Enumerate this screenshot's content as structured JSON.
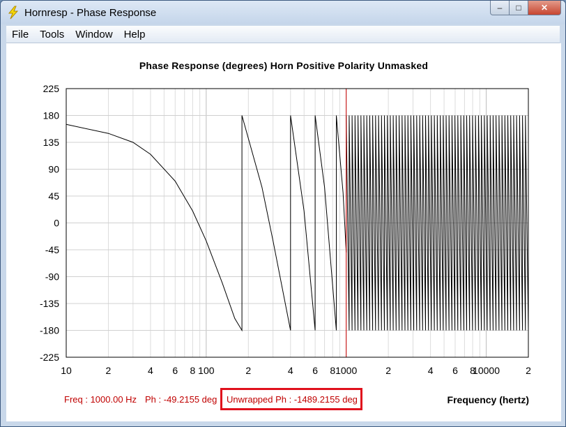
{
  "window": {
    "title": "Hornresp - Phase Response",
    "controls": {
      "minimize": "–",
      "maximize": "□",
      "close": "✕"
    }
  },
  "menu": [
    {
      "label": "File",
      "key": "file"
    },
    {
      "label": "Tools",
      "key": "tools"
    },
    {
      "label": "Window",
      "key": "window"
    },
    {
      "label": "Help",
      "key": "help"
    }
  ],
  "status": {
    "freq": "Freq : 1000.00 Hz",
    "phase": "Ph : -49.2155 deg",
    "unwrapped": "Unwrapped Ph : -1489.2155 deg"
  },
  "colors": {
    "status": "#c00000",
    "highlight": "#e0101c",
    "marker": "#cc0000",
    "trace": "#000000",
    "grid": "#cccccc"
  },
  "chart_data": {
    "type": "line",
    "title": "Phase Response (degrees)   Horn   Positive Polarity   Unmasked",
    "xlabel": "Frequency (hertz)",
    "ylabel": "",
    "xscale": "log",
    "xlim": [
      10,
      20000
    ],
    "ylim": [
      -225,
      225
    ],
    "grid": true,
    "yticks": [
      225,
      180,
      135,
      90,
      45,
      0,
      -45,
      -90,
      -135,
      -180,
      -225
    ],
    "xtick_labels": [
      {
        "v": 10,
        "t": "10"
      },
      {
        "v": 20,
        "t": "2"
      },
      {
        "v": 40,
        "t": "4"
      },
      {
        "v": 60,
        "t": "6"
      },
      {
        "v": 80,
        "t": "8"
      },
      {
        "v": 100,
        "t": "100"
      },
      {
        "v": 200,
        "t": "2"
      },
      {
        "v": 400,
        "t": "4"
      },
      {
        "v": 600,
        "t": "6"
      },
      {
        "v": 800,
        "t": "8"
      },
      {
        "v": 1000,
        "t": "1000"
      },
      {
        "v": 2000,
        "t": "2"
      },
      {
        "v": 4000,
        "t": "4"
      },
      {
        "v": 6000,
        "t": "6"
      },
      {
        "v": 8000,
        "t": "8"
      },
      {
        "v": 10000,
        "t": "10000"
      },
      {
        "v": 20000,
        "t": "2"
      }
    ],
    "marker_frequency": 1000,
    "series": [
      {
        "x": [
          10,
          20,
          30,
          40,
          60,
          80,
          100,
          130,
          160,
          180,
          180,
          250,
          300,
          400,
          400,
          500,
          600,
          600,
          700,
          850,
          850,
          950,
          1000
        ],
        "y": [
          165,
          150,
          135,
          115,
          70,
          20,
          -30,
          -100,
          -160,
          -180,
          180,
          60,
          -30,
          -180,
          180,
          20,
          -180,
          180,
          60,
          -180,
          180,
          50,
          -49.2155
        ]
      }
    ]
  }
}
